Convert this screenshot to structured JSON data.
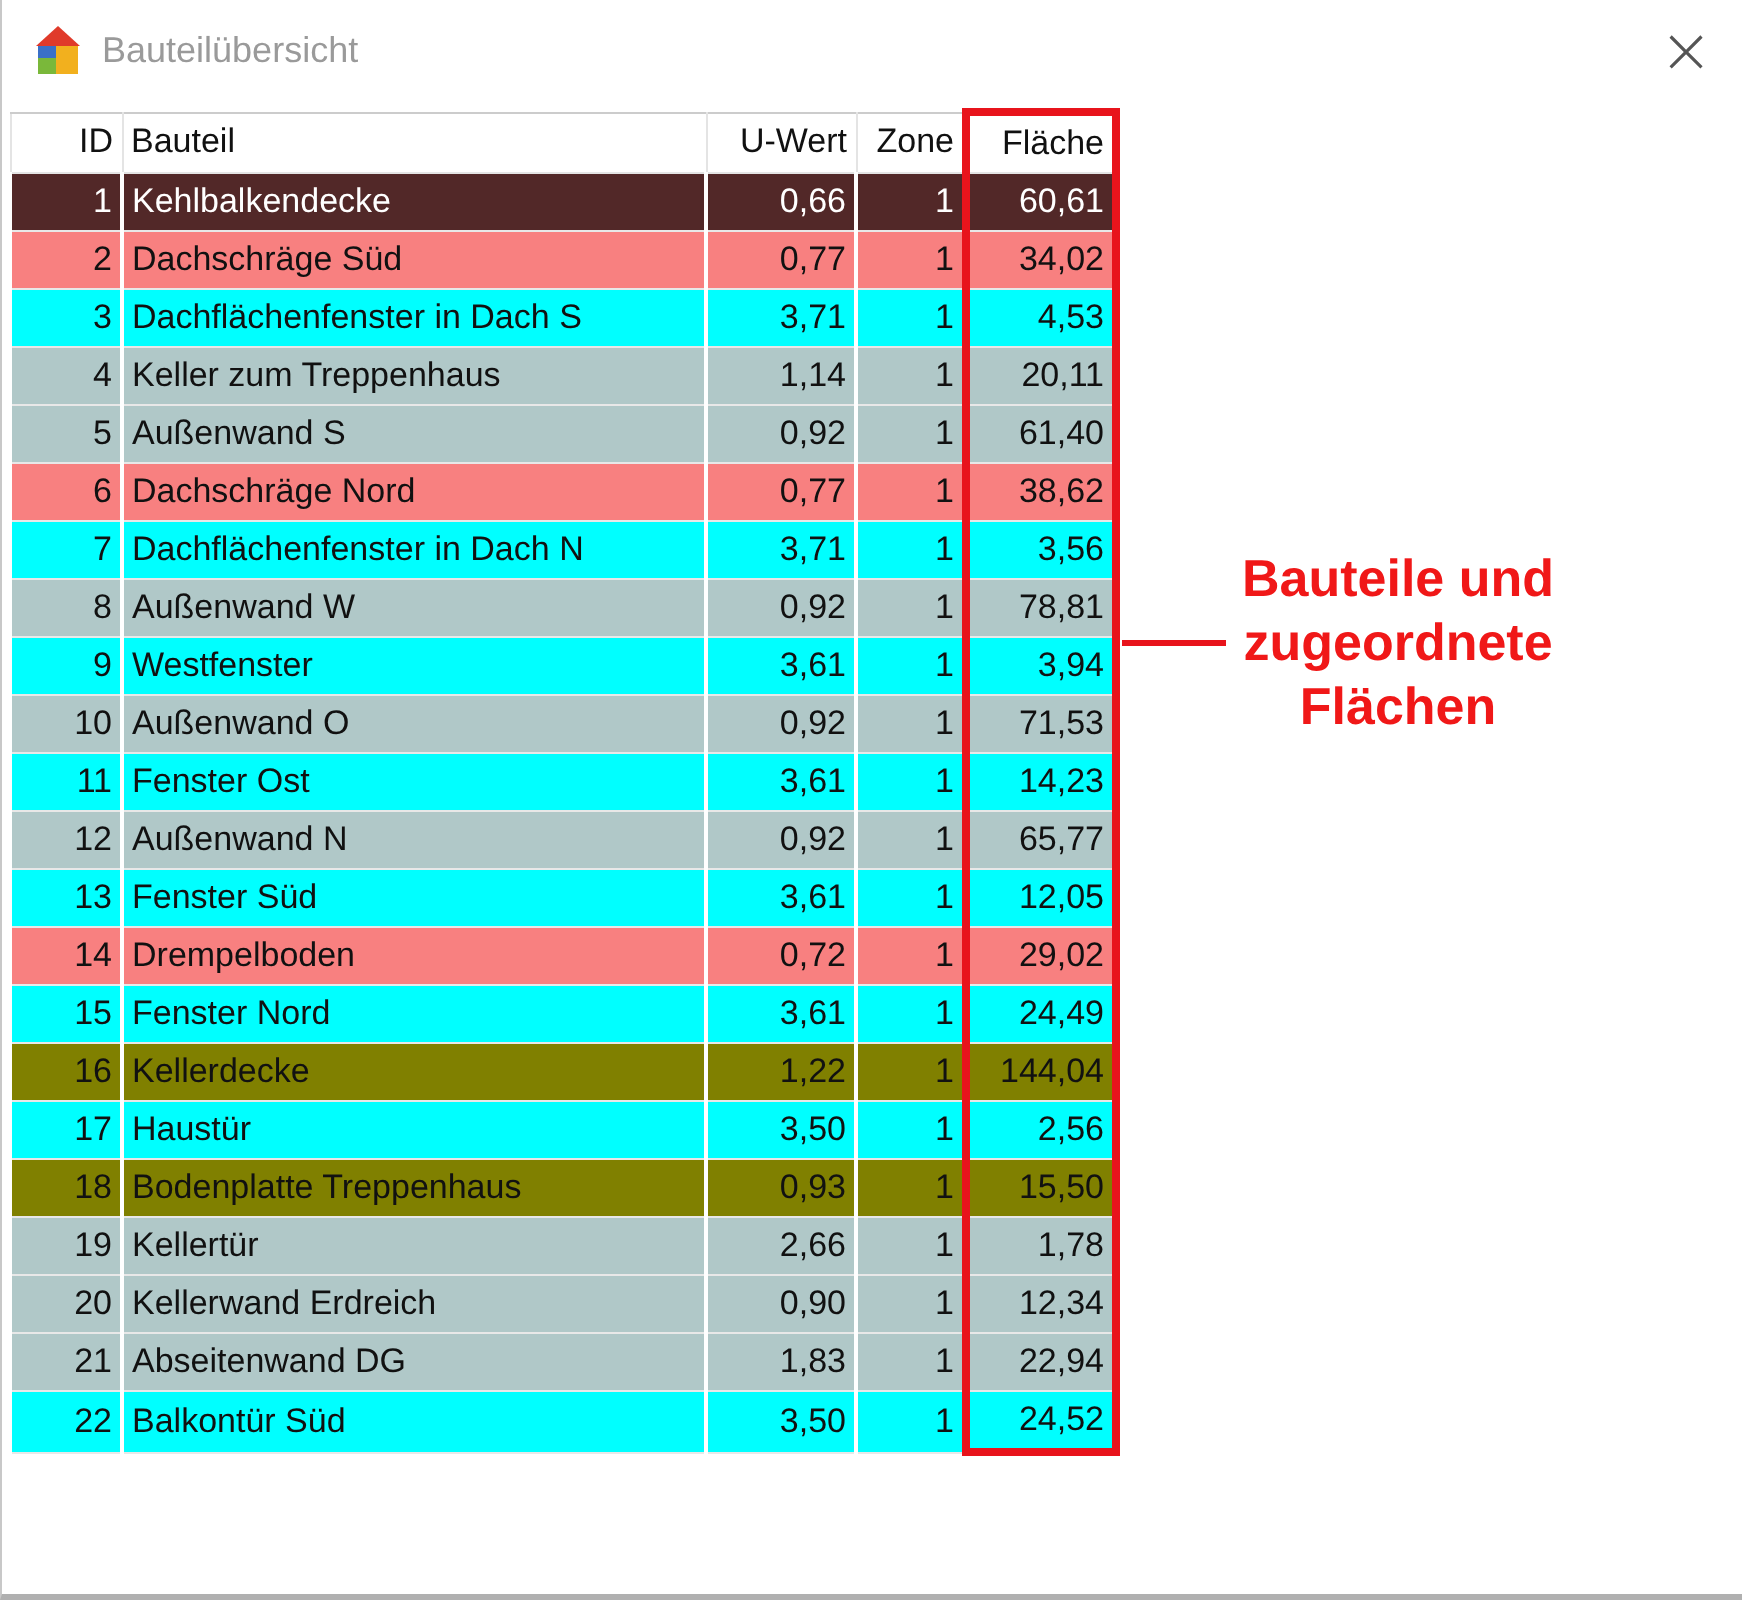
{
  "window": {
    "title": "Bauteilübersicht",
    "close": "×"
  },
  "table": {
    "columns": [
      {
        "label": "ID",
        "highlighted": false
      },
      {
        "label": "Bauteil",
        "highlighted": false
      },
      {
        "label": "U-Wert",
        "highlighted": false
      },
      {
        "label": "Zone",
        "highlighted": false
      },
      {
        "label": "Fläche",
        "highlighted": true
      }
    ],
    "rows": [
      {
        "cells": [
          "1",
          "Kehlbalkendecke",
          "0,66",
          "1",
          "60,61"
        ],
        "color": "#522828"
      },
      {
        "cells": [
          "2",
          "Dachschräge Süd",
          "0,77",
          "1",
          "34,02"
        ],
        "color": "#f88080"
      },
      {
        "cells": [
          "3",
          "Dachflächenfenster in Dach S",
          "3,71",
          "1",
          "4,53"
        ],
        "color": "#00ffff"
      },
      {
        "cells": [
          "4",
          "Keller zum Treppenhaus",
          "1,14",
          "1",
          "20,11"
        ],
        "color": "#b0c8c8"
      },
      {
        "cells": [
          "5",
          "Außenwand S",
          "0,92",
          "1",
          "61,40"
        ],
        "color": "#b0c8c8"
      },
      {
        "cells": [
          "6",
          "Dachschräge Nord",
          "0,77",
          "1",
          "38,62"
        ],
        "color": "#f88080"
      },
      {
        "cells": [
          "7",
          "Dachflächenfenster in Dach N",
          "3,71",
          "1",
          "3,56"
        ],
        "color": "#00ffff"
      },
      {
        "cells": [
          "8",
          "Außenwand W",
          "0,92",
          "1",
          "78,81"
        ],
        "color": "#b0c8c8"
      },
      {
        "cells": [
          "9",
          "Westfenster",
          "3,61",
          "1",
          "3,94"
        ],
        "color": "#00ffff"
      },
      {
        "cells": [
          "10",
          "Außenwand O",
          "0,92",
          "1",
          "71,53"
        ],
        "color": "#b0c8c8"
      },
      {
        "cells": [
          "11",
          "Fenster Ost",
          "3,61",
          "1",
          "14,23"
        ],
        "color": "#00ffff"
      },
      {
        "cells": [
          "12",
          "Außenwand N",
          "0,92",
          "1",
          "65,77"
        ],
        "color": "#b0c8c8"
      },
      {
        "cells": [
          "13",
          "Fenster Süd",
          "3,61",
          "1",
          "12,05"
        ],
        "color": "#00ffff"
      },
      {
        "cells": [
          "14",
          "Drempelboden",
          "0,72",
          "1",
          "29,02"
        ],
        "color": "#f88080"
      },
      {
        "cells": [
          "15",
          "Fenster Nord",
          "3,61",
          "1",
          "24,49"
        ],
        "color": "#00ffff"
      },
      {
        "cells": [
          "16",
          "Kellerdecke",
          "1,22",
          "1",
          "144,04"
        ],
        "color": "#808000"
      },
      {
        "cells": [
          "17",
          "Haustür",
          "3,50",
          "1",
          "2,56"
        ],
        "color": "#00ffff"
      },
      {
        "cells": [
          "18",
          "Bodenplatte Treppenhaus",
          "0,93",
          "1",
          "15,50"
        ],
        "color": "#808000"
      },
      {
        "cells": [
          "19",
          "Kellertür",
          "2,66",
          "1",
          "1,78"
        ],
        "color": "#b0c8c8"
      },
      {
        "cells": [
          "20",
          "Kellerwand Erdreich",
          "0,90",
          "1",
          "12,34"
        ],
        "color": "#b0c8c8"
      },
      {
        "cells": [
          "21",
          "Abseitenwand DG",
          "1,83",
          "1",
          "22,94"
        ],
        "color": "#b0c8c8"
      },
      {
        "cells": [
          "22",
          "Balkontür Süd",
          "3,50",
          "1",
          "24,52"
        ],
        "color": "#00ffff"
      }
    ]
  },
  "callout": {
    "lines": [
      "Bauteile und",
      "zugeordnete",
      "Flächen"
    ]
  }
}
